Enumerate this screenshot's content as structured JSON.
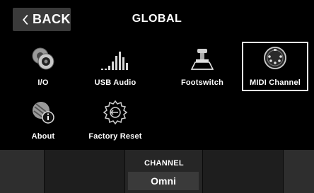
{
  "header": {
    "back_label": "BACK",
    "title": "GLOBAL"
  },
  "tiles": [
    {
      "label": "I/O",
      "icon": "io-icon"
    },
    {
      "label": "USB Audio",
      "icon": "usb-audio-icon"
    },
    {
      "label": "Footswitch",
      "icon": "footswitch-icon"
    },
    {
      "label": "MIDI Channel",
      "icon": "midi-din-icon",
      "selected": true
    },
    {
      "label": "About",
      "icon": "about-icon"
    },
    {
      "label": "Factory Reset",
      "icon": "factory-reset-icon"
    }
  ],
  "channel": {
    "label": "CHANNEL",
    "value": "Omni"
  }
}
